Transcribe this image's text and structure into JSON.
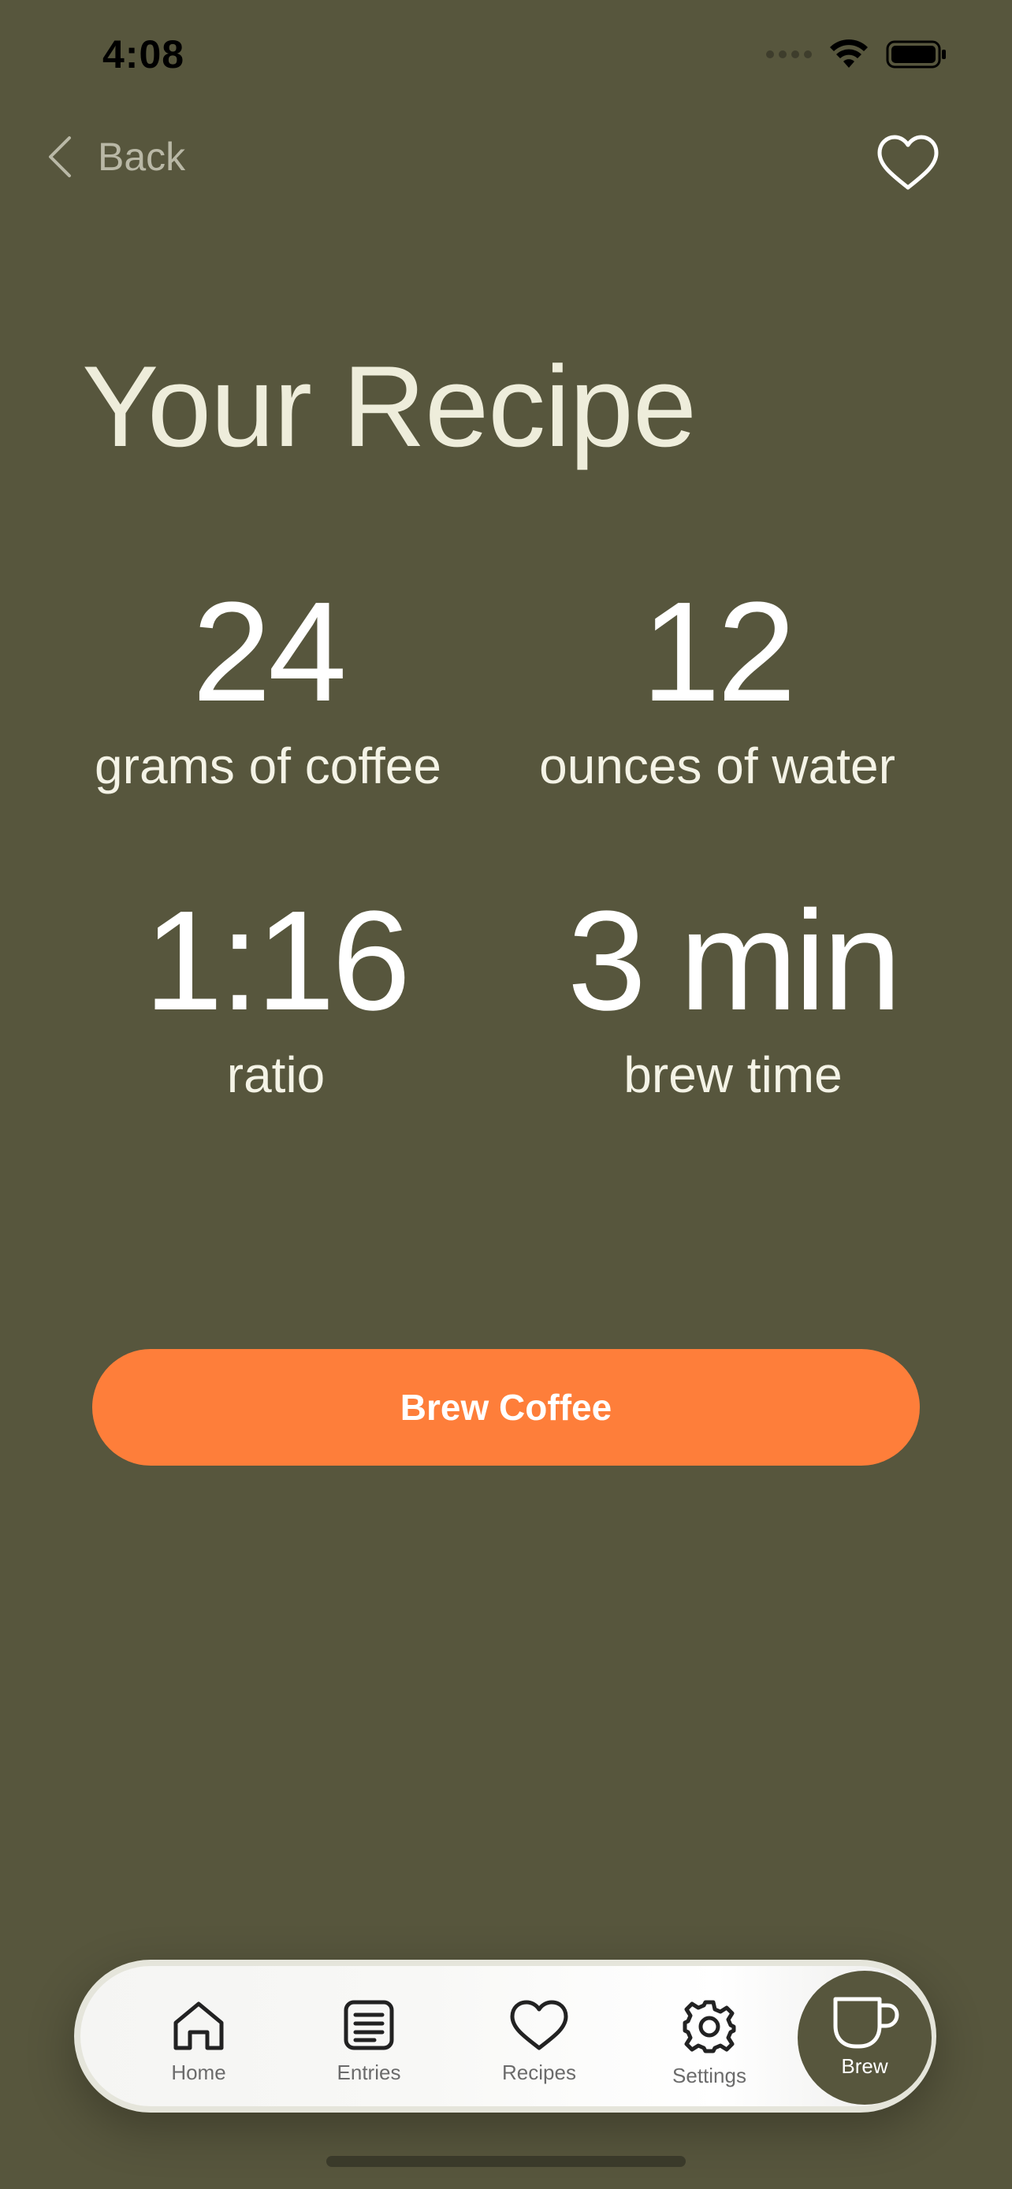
{
  "status_bar": {
    "time": "4:08"
  },
  "nav": {
    "back_label": "Back"
  },
  "page": {
    "title": "Your Recipe"
  },
  "stats": {
    "coffee": {
      "value": "24",
      "label": "grams of coffee"
    },
    "water": {
      "value": "12",
      "label": "ounces of water"
    },
    "ratio": {
      "value": "1:16",
      "label": "ratio"
    },
    "time": {
      "value": "3 min",
      "label": "brew time"
    }
  },
  "actions": {
    "brew_label": "Brew Coffee"
  },
  "tabbar": {
    "tabs": [
      {
        "label": "Home",
        "icon": "home-icon"
      },
      {
        "label": "Entries",
        "icon": "entries-icon"
      },
      {
        "label": "Recipes",
        "icon": "heart-icon"
      },
      {
        "label": "Settings",
        "icon": "gear-icon"
      },
      {
        "label": "Brew",
        "icon": "cup-icon",
        "active": true
      }
    ]
  },
  "colors": {
    "background": "#57563d",
    "accent": "#fe7e3a",
    "title_text": "#eeeddb"
  }
}
